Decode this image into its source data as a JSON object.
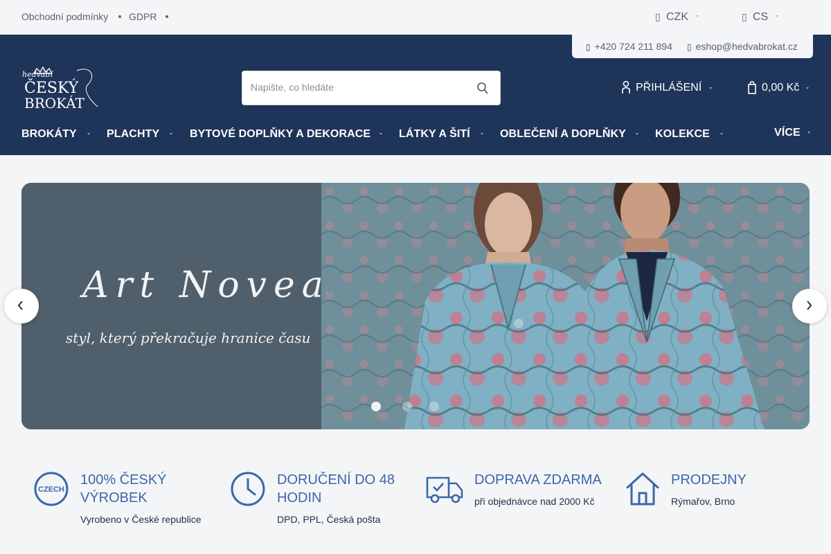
{
  "topbar": {
    "links": [
      "Obchodní podmínky",
      "GDPR"
    ],
    "currency": "CZK",
    "language": "CS"
  },
  "contact": {
    "phone": "+420 724 211 894",
    "email": "eshop@hedvabrokat.cz"
  },
  "logo": {
    "line1": "hedvábí",
    "line2": "ČESKÝ",
    "line3": "BROKÁT"
  },
  "search": {
    "placeholder": "Napište, co hledáte"
  },
  "account": {
    "login_label": "PŘIHLÁŠENÍ",
    "cart_total": "0,00 Kč"
  },
  "nav": {
    "items": [
      "BROKÁTY",
      "PLACHTY",
      "BYTOVÉ DOPLŇKY A DEKORACE",
      "LÁTKY A ŠITÍ",
      "OBLEČENÍ A DOPLŇKY",
      "KOLEKCE"
    ],
    "more": "VÍCE"
  },
  "banner": {
    "title": "Art Noveau",
    "subtitle": "styl, který překračuje hranice času",
    "slide_count": 3,
    "active_slide": 1
  },
  "features": [
    {
      "icon": "czech-badge-icon",
      "title": "100% ČESKÝ VÝROBEK",
      "subtitle": "Vyrobeno v České republice",
      "badge": "CZECH"
    },
    {
      "icon": "clock-icon",
      "title": "DORUČENÍ DO 48 HODIN",
      "subtitle": "DPD, PPL, Česká pošta"
    },
    {
      "icon": "delivery-truck-icon",
      "title": "DOPRAVA ZDARMA",
      "subtitle": "při objednávce nad 2000 Kč"
    },
    {
      "icon": "store-house-icon",
      "title": "PRODEJNY",
      "subtitle": "Rýmařov, Brno"
    }
  ],
  "colors": {
    "header_bg": "#1f3459",
    "accent_blue": "#3b66a8",
    "banner_left": "#4f5f6b",
    "fabric_blue": "#7fb0c4",
    "fabric_pink": "#c9788a"
  }
}
